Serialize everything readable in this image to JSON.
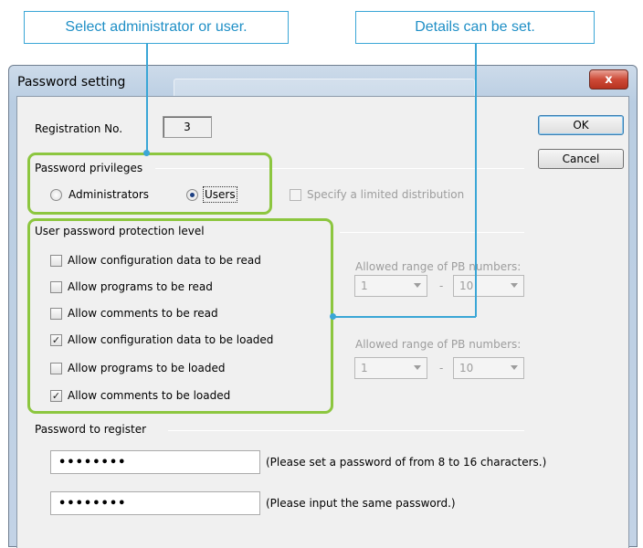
{
  "callouts": {
    "left": "Select administrator or user.",
    "right": "Details can be set."
  },
  "window": {
    "title": "Password setting",
    "close_glyph": "x"
  },
  "registration": {
    "label": "Registration No.",
    "value": "3"
  },
  "buttons": {
    "ok": "OK",
    "cancel": "Cancel"
  },
  "privileges": {
    "group_label": "Password privileges",
    "administrators": "Administrators",
    "users": "Users",
    "selected": "Users",
    "limited_distribution": "Specify a limited distribution"
  },
  "protection": {
    "group_label": "User password protection level",
    "items": [
      {
        "label": "Allow configuration data to be read",
        "checked": false
      },
      {
        "label": "Allow programs to be read",
        "checked": false
      },
      {
        "label": "Allow comments to be read",
        "checked": false
      },
      {
        "label": "Allow configuration data to be loaded",
        "checked": true
      },
      {
        "label": "Allow programs to be loaded",
        "checked": false
      },
      {
        "label": "Allow comments to be loaded",
        "checked": true
      }
    ],
    "read_range": {
      "label": "Allowed range of PB numbers:",
      "from": "1",
      "dash": "-",
      "to": "10"
    },
    "load_range": {
      "label": "Allowed range of PB numbers:",
      "from": "1",
      "dash": "-",
      "to": "10"
    }
  },
  "register": {
    "group_label": "Password to register",
    "password_value": "••••••••",
    "password_hint": "(Please set a password of from 8 to 16 characters.)",
    "confirm_value": "••••••••",
    "confirm_hint": "(Please input the same password.)"
  },
  "colors": {
    "callout": "#3aa6d6",
    "highlight": "#8cc63f",
    "close_button": "#cd4a37"
  }
}
